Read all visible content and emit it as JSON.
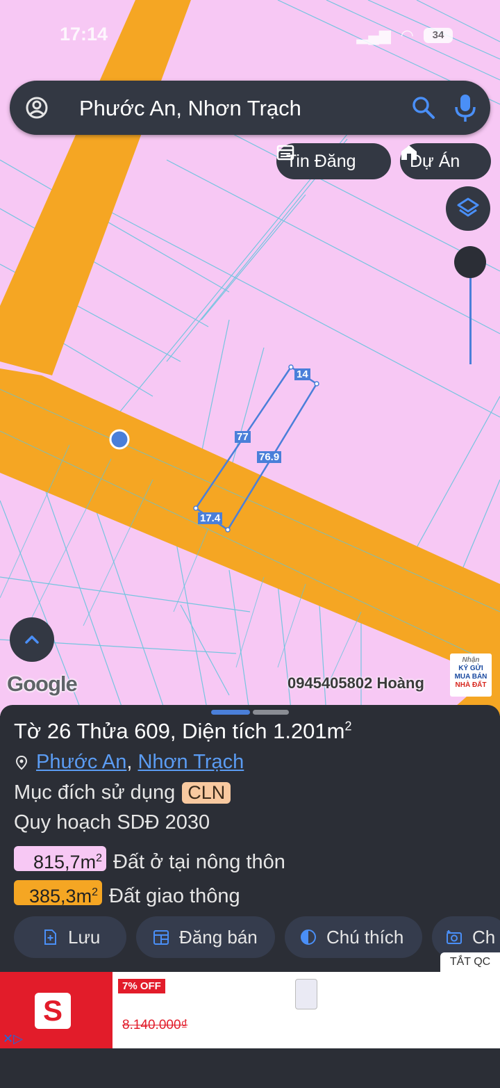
{
  "status_bar": {
    "time": "17:14",
    "battery": "34"
  },
  "search": {
    "value": "Phước An, Nhơn Trạch"
  },
  "chips": {
    "listings": "Tin Đăng",
    "projects": "Dự Án"
  },
  "map": {
    "measurements": {
      "top": "14",
      "left": "77",
      "right": "76.9",
      "bottom": "17.4"
    },
    "google_logo": "Google",
    "watermark": "0945405802 Hoàng",
    "logo_badge": {
      "line1": "Nhận",
      "line2": "KÝ GỬI",
      "line3": "MUA BÁN",
      "line4": "NHÀ ĐẤT"
    }
  },
  "parcel": {
    "title_prefix": "Tờ 26 Thửa 609, Diện tích 1.201m",
    "title_sup": "2",
    "ward": "Phước An",
    "separator": ",",
    "district": "Nhơn Trạch",
    "purpose_label": "Mục đích sử dụng",
    "purpose_code": "CLN",
    "plan_label": "Quy hoạch SDĐ 2030",
    "areas": [
      {
        "value": "815,7m",
        "sup": "2",
        "label": "Đất ở tại nông thôn",
        "color": "#f7c8f4"
      },
      {
        "value": "385,3m",
        "sup": "2",
        "label": "Đất giao thông",
        "color": "#f5a623"
      }
    ]
  },
  "actions": {
    "save": "Lưu",
    "sell": "Đăng bán",
    "legend": "Chú thích",
    "capture": "Ch"
  },
  "ad": {
    "close": "TẮT QC",
    "discount": "7% OFF",
    "price": "8.140.000₫",
    "brand_letter": "S"
  },
  "colors": {
    "residential": "#f7c8f4",
    "road": "#f5a623",
    "accent": "#4a7fd9",
    "sheet_bg": "#2b2e36"
  }
}
